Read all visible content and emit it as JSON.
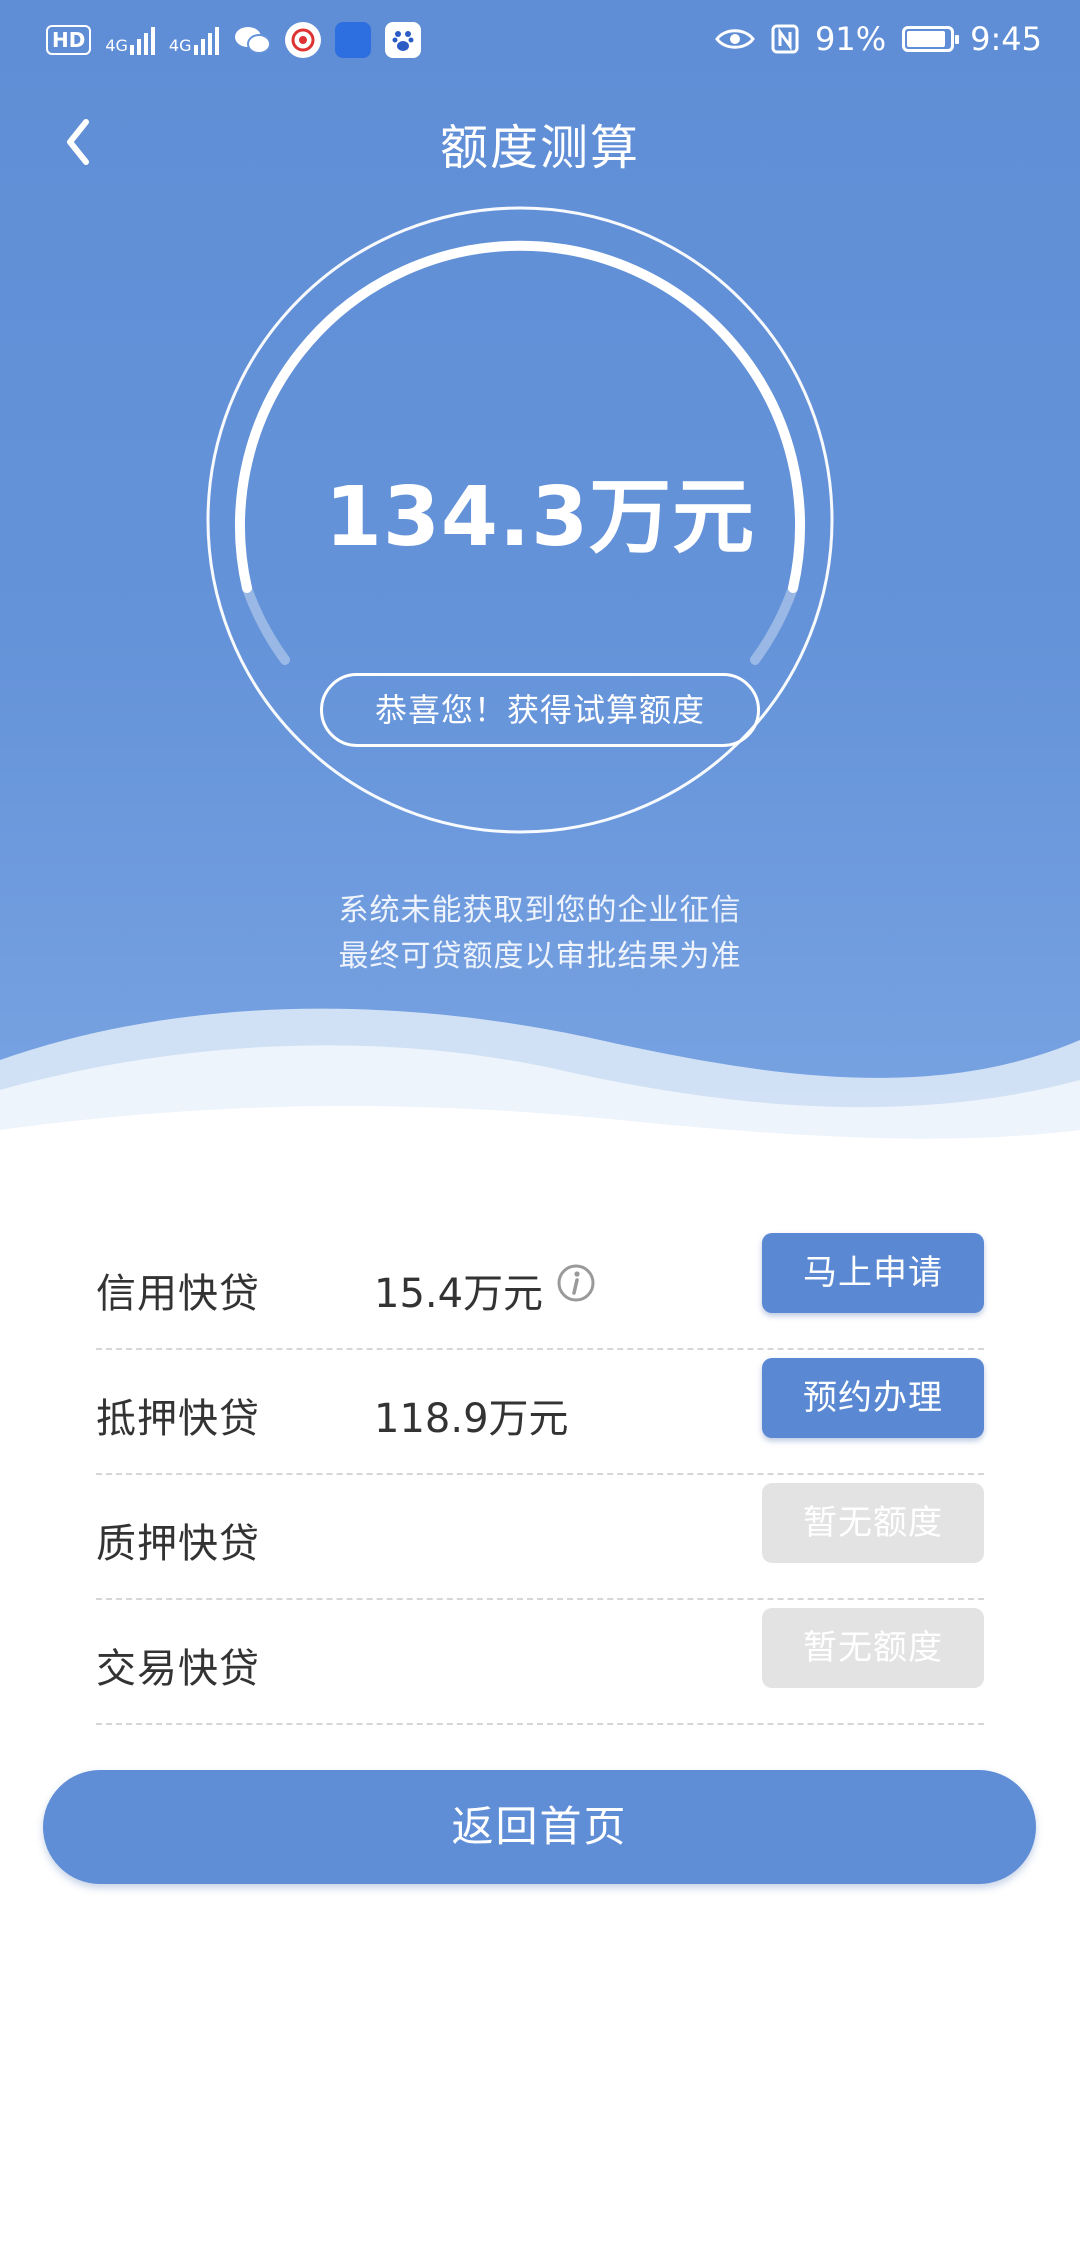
{
  "status_bar": {
    "hd_label": "HD",
    "network_1": "4G",
    "network_2": "4G",
    "battery_percent": "91%",
    "battery_level": 0.91,
    "time": "9:45",
    "icons": [
      "hd-icon",
      "signal-icon",
      "signal-icon",
      "wechat-icon",
      "app-icon",
      "autohome-icon",
      "baidu-icon",
      "eye-icon",
      "nfc-icon",
      "battery-icon"
    ]
  },
  "header": {
    "title": "额度测算"
  },
  "result": {
    "amount": "134.3万元",
    "congrats": "恭喜您！获得试算额度",
    "notice_line1": "系统未能获取到您的企业征信",
    "notice_line2": "最终可贷额度以审批结果为准"
  },
  "products": [
    {
      "name": "信用快贷",
      "amount": "15.4万元",
      "has_info": true,
      "button": "马上申请",
      "enabled": true
    },
    {
      "name": "抵押快贷",
      "amount": "118.9万元",
      "has_info": false,
      "button": "预约办理",
      "enabled": true
    },
    {
      "name": "质押快贷",
      "amount": "",
      "has_info": false,
      "button": "暂无额度",
      "enabled": false
    },
    {
      "name": "交易快贷",
      "amount": "",
      "has_info": false,
      "button": "暂无额度",
      "enabled": false
    }
  ],
  "footer": {
    "home_button": "返回首页"
  },
  "colors": {
    "primary": "#5f8ed6",
    "button_active": "#5a88d2",
    "button_disabled": "#e3e3e3"
  }
}
